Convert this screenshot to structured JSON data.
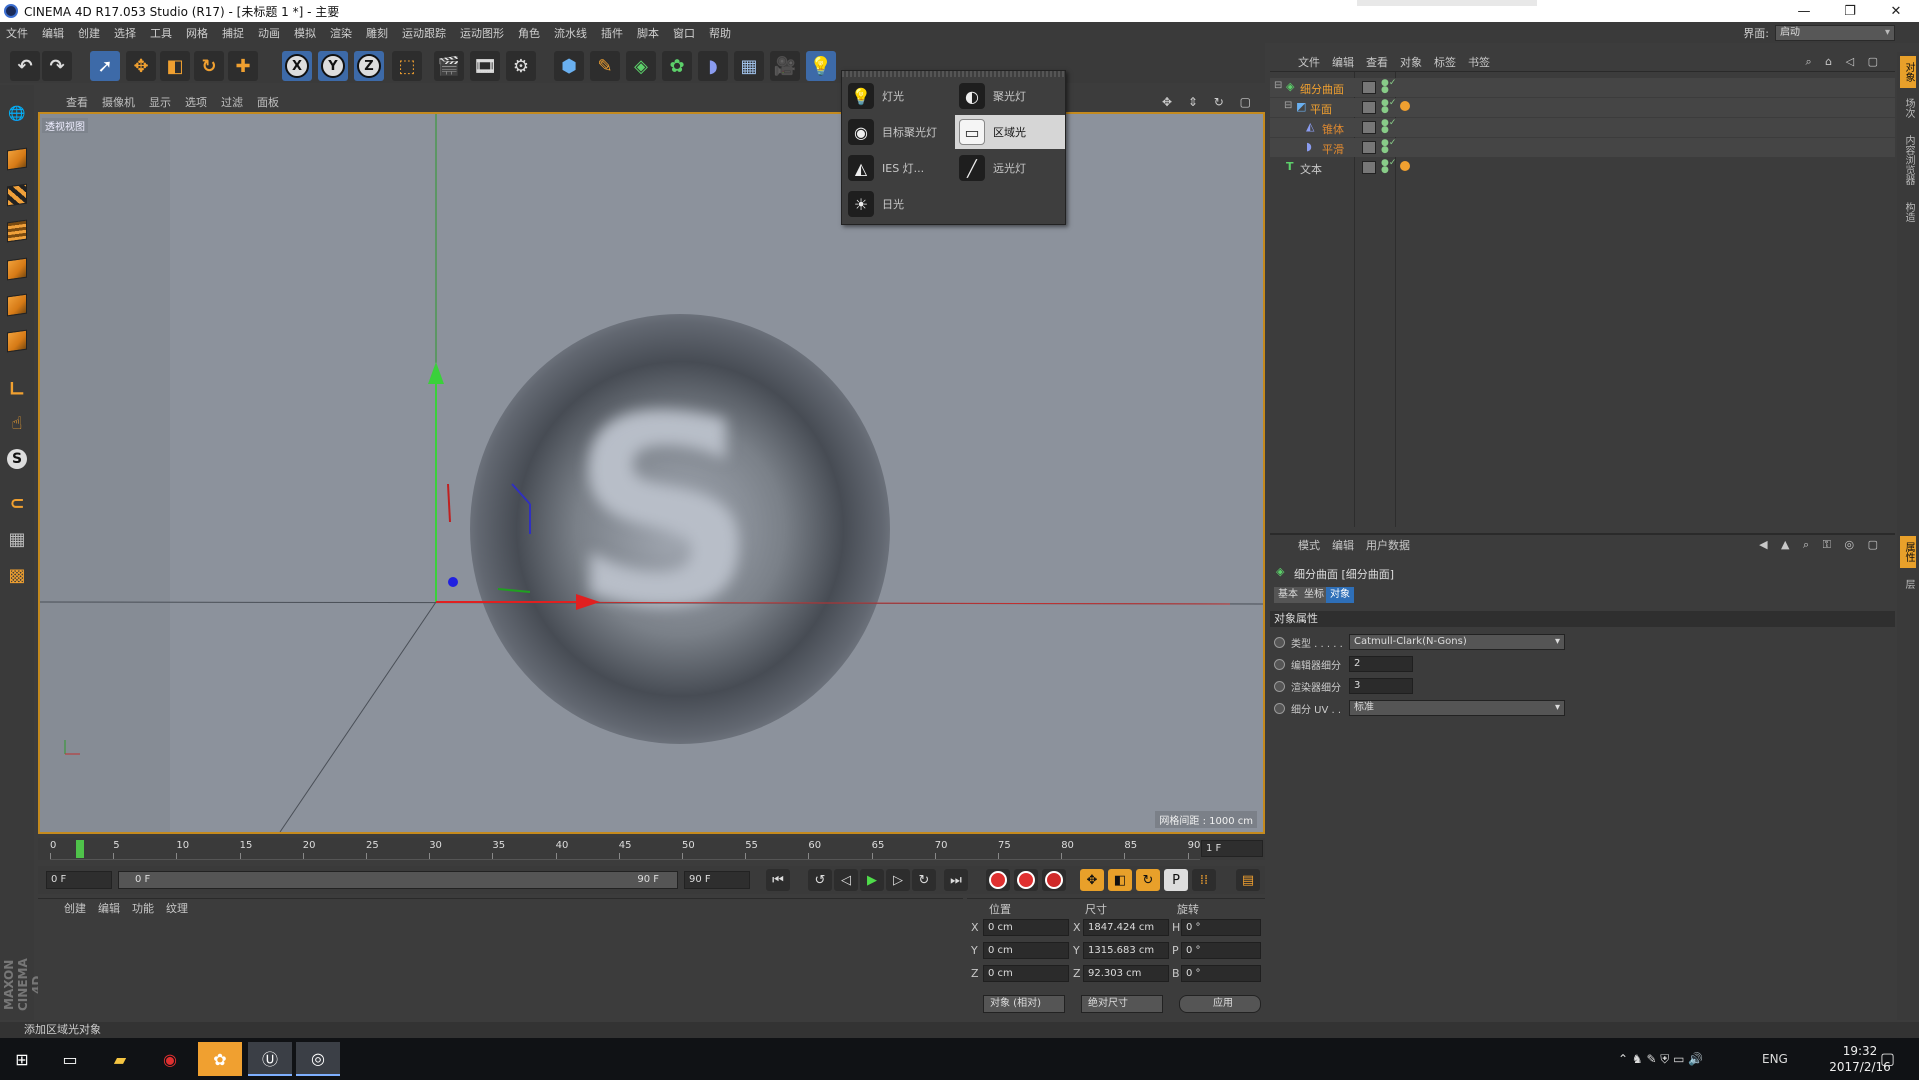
{
  "window": {
    "title": "CINEMA 4D R17.053 Studio (R17) - [未标题 1 *] - 主要",
    "minimize": "—",
    "maximize": "❐",
    "close": "✕"
  },
  "menubar": {
    "items": [
      "文件",
      "编辑",
      "创建",
      "选择",
      "工具",
      "网格",
      "捕捉",
      "动画",
      "模拟",
      "渲染",
      "雕刻",
      "运动跟踪",
      "运动图形",
      "角色",
      "流水线",
      "插件",
      "脚本",
      "窗口",
      "帮助"
    ],
    "layout_label": "界面:",
    "layout_value": "启动"
  },
  "toolbar": {
    "axis_x": "X",
    "axis_y": "Y",
    "axis_z": "Z"
  },
  "viewport": {
    "menus": [
      "查看",
      "摄像机",
      "显示",
      "选项",
      "过滤",
      "面板"
    ],
    "label": "透视视图",
    "grid_spacing": "网格间距 : 1000 cm",
    "nav_icons": "✥ ⇕ ↻ ▢",
    "scene_letter": "S"
  },
  "light_menu": {
    "items": [
      {
        "label": "灯光",
        "icon": "bulb-icon",
        "glyph": "💡"
      },
      {
        "label": "聚光灯",
        "icon": "spotlight-icon",
        "glyph": "◐"
      },
      {
        "label": "目标聚光灯",
        "icon": "target-spot-icon",
        "glyph": "◉"
      },
      {
        "label": "区域光",
        "icon": "area-light-icon",
        "glyph": "▭"
      },
      {
        "label": "IES 灯...",
        "icon": "ies-light-icon",
        "glyph": "◭"
      },
      {
        "label": "远光灯",
        "icon": "infinite-light-icon",
        "glyph": "╱"
      },
      {
        "label": "日光",
        "icon": "sun-icon",
        "glyph": "☀"
      }
    ],
    "selected": "区域光"
  },
  "timeline": {
    "ticks": [
      "0",
      "5",
      "10",
      "15",
      "20",
      "25",
      "30",
      "35",
      "40",
      "45",
      "50",
      "55",
      "60",
      "65",
      "70",
      "75",
      "80",
      "85",
      "90"
    ],
    "current_frame": "1 F",
    "start_field": "0 F",
    "scrub_start": "0 F",
    "scrub_end": "90 F",
    "end_field": "90 F"
  },
  "material_manager": {
    "menus": [
      "创建",
      "编辑",
      "功能",
      "纹理"
    ]
  },
  "coordinates": {
    "headers": [
      "位置",
      "尺寸",
      "旋转"
    ],
    "rows": [
      {
        "axis": "X",
        "pos": "0 cm",
        "size_axis": "X",
        "size": "1847.424 cm",
        "rot_axis": "H",
        "rot": "0 °"
      },
      {
        "axis": "Y",
        "pos": "0 cm",
        "size_axis": "Y",
        "size": "1315.683 cm",
        "rot_axis": "P",
        "rot": "0 °"
      },
      {
        "axis": "Z",
        "pos": "0 cm",
        "size_axis": "Z",
        "size": "92.303 cm",
        "rot_axis": "B",
        "rot": "0 °"
      }
    ],
    "mode_dropdown": "对象 (相对)",
    "size_dropdown": "绝对尺寸",
    "apply": "应用"
  },
  "status": "添加区域光对象",
  "object_manager": {
    "menus": [
      "文件",
      "编辑",
      "查看",
      "对象",
      "标签",
      "书签"
    ],
    "objects": [
      {
        "name": "细分曲面",
        "color": "#f0a030"
      },
      {
        "name": "平面",
        "color": "#f0a030"
      },
      {
        "name": "锥体",
        "color": "#e08a30"
      },
      {
        "name": "平滑",
        "color": "#e08a30"
      },
      {
        "name": "文本",
        "color": "#c8c8c8"
      }
    ]
  },
  "attribute_manager": {
    "menus": [
      "模式",
      "编辑",
      "用户数据"
    ],
    "object_title": "细分曲面 [细分曲面]",
    "tabs": [
      "基本",
      "坐标",
      "对象"
    ],
    "active_tab": "对象",
    "section": "对象属性",
    "props": [
      {
        "label": "类型 . . . . .",
        "value": "Catmull-Clark(N-Gons)",
        "kind": "dropdown"
      },
      {
        "label": "编辑器细分",
        "value": "2",
        "kind": "number"
      },
      {
        "label": "渲染器细分",
        "value": "3",
        "kind": "number"
      },
      {
        "label": "细分 UV . .",
        "value": "标准",
        "kind": "dropdown"
      }
    ]
  },
  "right_strip": [
    "对象",
    "场次",
    "内容浏览器",
    "构造",
    "属性",
    "层"
  ],
  "maxon_logo": "MAXON CINEMA 4D",
  "taskbar": {
    "tray_lang": "ENG",
    "time": "19:32",
    "date": "2017/2/16"
  },
  "colors": {
    "accent_orange": "#c48a1e",
    "selection_blue": "#2e6fb8",
    "viewport_gray": "#8c929c"
  }
}
